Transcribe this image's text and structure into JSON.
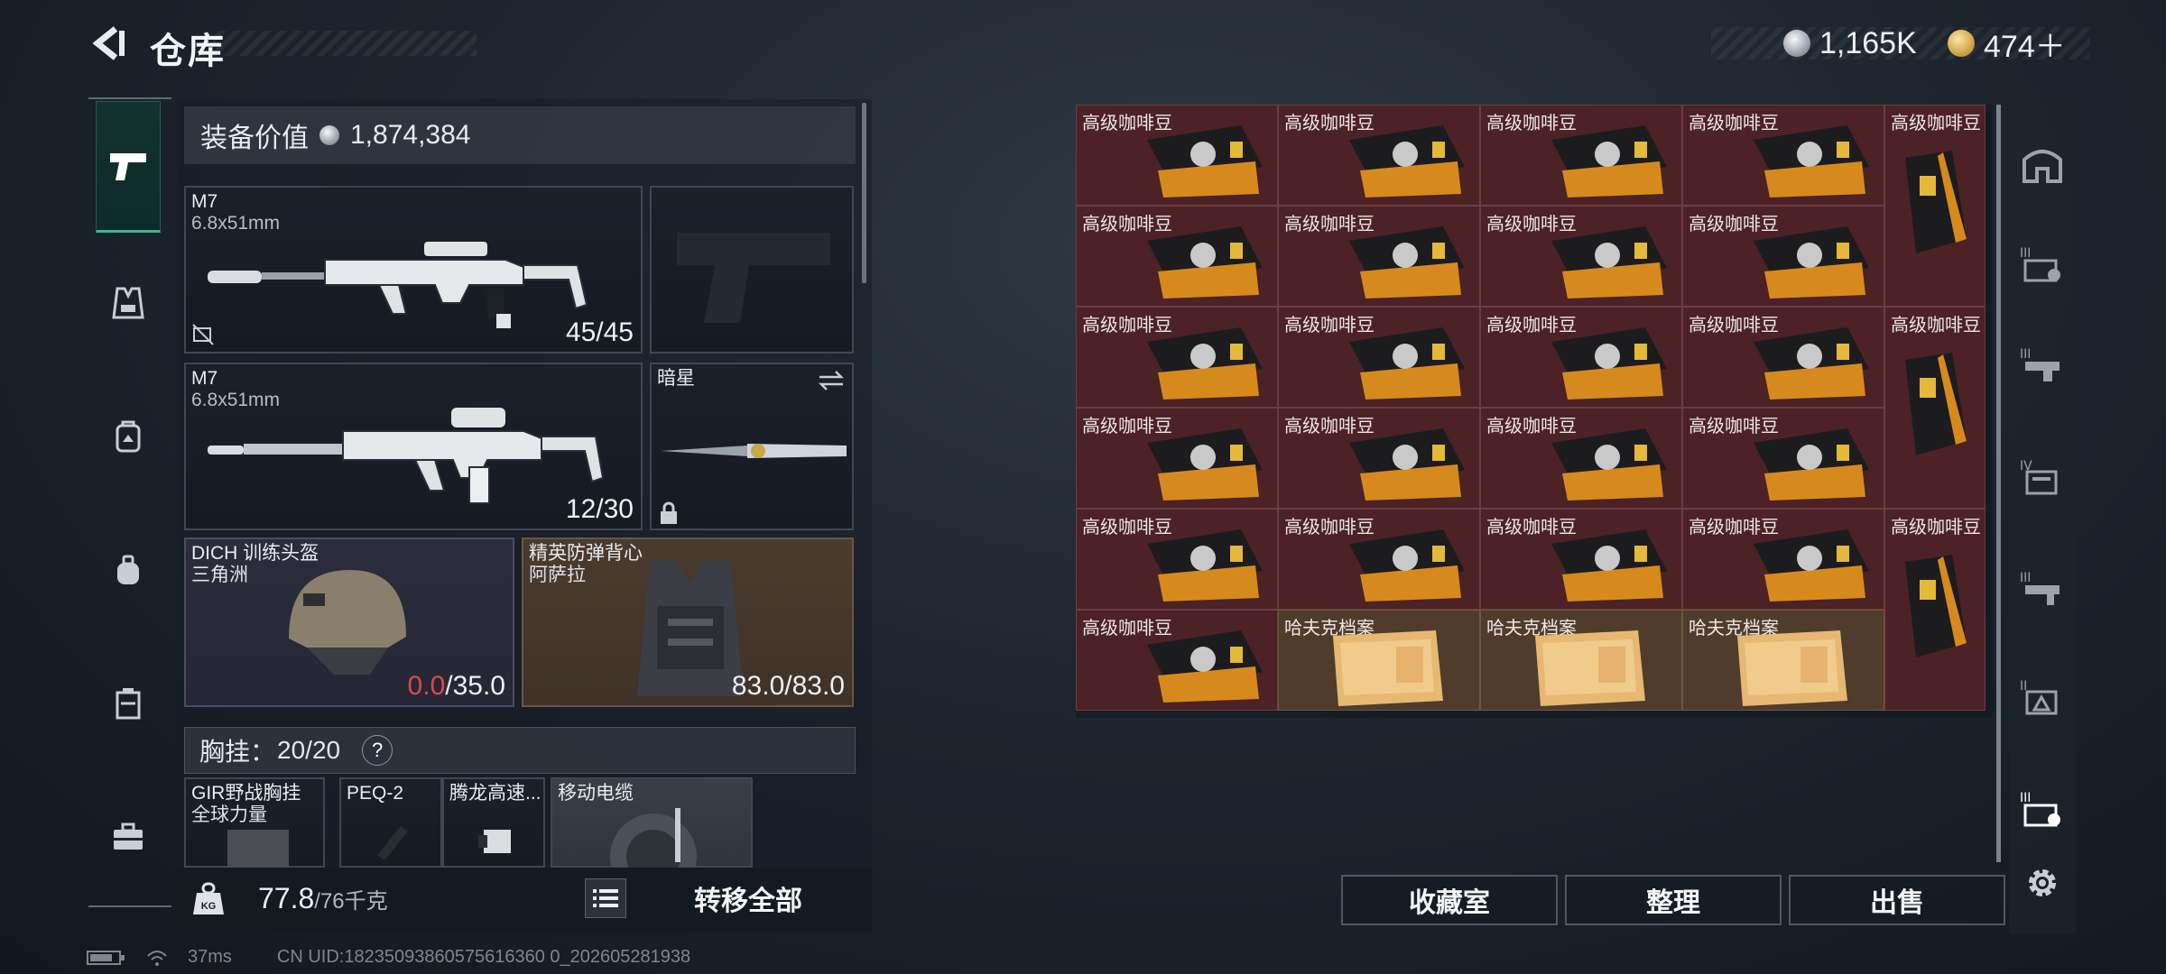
{
  "header": {
    "title": "仓库",
    "currency": [
      {
        "icon": "silver-coin-icon",
        "value": "1,165K"
      },
      {
        "icon": "gold-coin-icon",
        "value": "474＋"
      }
    ]
  },
  "equipment": {
    "value_label": "装备价值",
    "value": "1,874,384",
    "primary_weapon_1": {
      "name": "M7",
      "caliber": "6.8x51mm",
      "ammo": "45/45"
    },
    "primary_weapon_2": {
      "name": "M7",
      "caliber": "6.8x51mm",
      "ammo": "12/30"
    },
    "melee": {
      "name": "暗星"
    },
    "helmet": {
      "name": "DICH 训练头盔",
      "sub": "三角洲",
      "durability_current": "0.0",
      "durability_max": "/35.0"
    },
    "armor": {
      "name": "精英防弹背心",
      "sub": "阿萨拉",
      "durability": "83.0/83.0"
    },
    "chest_rig_label": "胸挂：",
    "chest_rig_value": "20/20",
    "chest_rig_help": "?",
    "small_slots": [
      {
        "name": "GIR野战胸挂",
        "sub": "全球力量"
      },
      {
        "name": "PEQ-2"
      },
      {
        "name": "腾龙高速..."
      },
      {
        "name": "移动电缆"
      }
    ],
    "weight_value": "77.8",
    "weight_max": "/76千克",
    "transfer_all": "转移全部"
  },
  "storage": {
    "coffee_label": "高级咖啡豆",
    "case_label": "哈夫克档案",
    "buttons": [
      "收藏室",
      "整理",
      "出售"
    ]
  },
  "status": {
    "ping": "37ms",
    "uid": "CN UID:18235093860575616360 0_202605281938"
  },
  "colors": {
    "accent_green": "#39b98e",
    "durability_red": "#e0464b",
    "item_cell_red": "#4c2226",
    "item_cell_orange": "#4f3c2c"
  }
}
